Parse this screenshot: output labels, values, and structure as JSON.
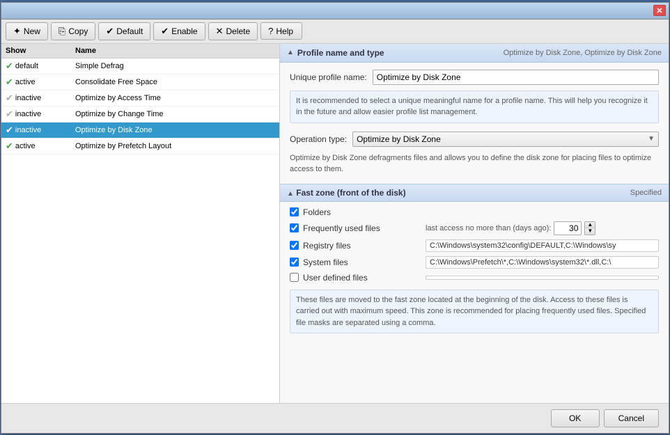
{
  "window": {
    "close_icon": "✕"
  },
  "toolbar": {
    "new_label": "New",
    "copy_label": "Copy",
    "default_label": "Default",
    "enable_label": "Enable",
    "delete_label": "Delete",
    "help_label": "Help"
  },
  "list": {
    "header_show": "Show",
    "header_name": "Name",
    "items": [
      {
        "status": "active",
        "check": "✔",
        "active": true,
        "label": "default",
        "name": "Simple Defrag"
      },
      {
        "status": "active",
        "check": "✔",
        "active": true,
        "label": "active",
        "name": "Consolidate Free Space"
      },
      {
        "status": "inactive",
        "check": "✔",
        "active": false,
        "label": "inactive",
        "name": "Optimize by Access Time"
      },
      {
        "status": "inactive",
        "check": "✔",
        "active": false,
        "label": "inactive",
        "name": "Optimize by Change Time"
      },
      {
        "status": "inactive",
        "check": "✔",
        "active": false,
        "label": "inactive",
        "name": "Optimize by Disk Zone",
        "selected": true
      },
      {
        "status": "active",
        "check": "✔",
        "active": true,
        "label": "active",
        "name": "Optimize by Prefetch Layout"
      }
    ]
  },
  "profile": {
    "section_title": "Profile name and type",
    "section_extra": "Optimize by Disk Zone, Optimize by Disk Zone",
    "unique_label": "Unique profile name:",
    "unique_value": "Optimize by Disk Zone",
    "hint": "It is recommended to select a unique meaningful name for a profile name. This will help you recognize it in the future and allow easier profile list management.",
    "op_label": "Operation type:",
    "op_value": "Optimize by Disk Zone",
    "op_hint": "Optimize by Disk Zone defragments files and allows you to define the disk zone for placing files to optimize access to them."
  },
  "fast_zone": {
    "section_title": "Fast zone (front of the disk)",
    "specified_label": "Specified",
    "folders_label": "Folders",
    "folders_checked": true,
    "freq_label": "Frequently used files",
    "freq_checked": true,
    "freq_days_label": "last access no more than (days ago):",
    "freq_days_value": "30",
    "registry_label": "Registry files",
    "registry_checked": true,
    "registry_value": "C:\\Windows\\system32\\config\\DEFAULT,C:\\Windows\\sy",
    "system_label": "System files",
    "system_checked": true,
    "system_value": "C:\\Windows\\Prefetch\\*,C:\\Windows\\system32\\*.dll,C:\\",
    "user_label": "User defined files",
    "user_checked": false,
    "user_value": "",
    "bottom_hint": "These files are moved to the fast zone located at the beginning of the disk. Access to these files is carried out with maximum speed. This zone is recommended for placing frequently used files. Specified file masks are separated using a comma."
  },
  "footer": {
    "ok_label": "OK",
    "cancel_label": "Cancel"
  }
}
